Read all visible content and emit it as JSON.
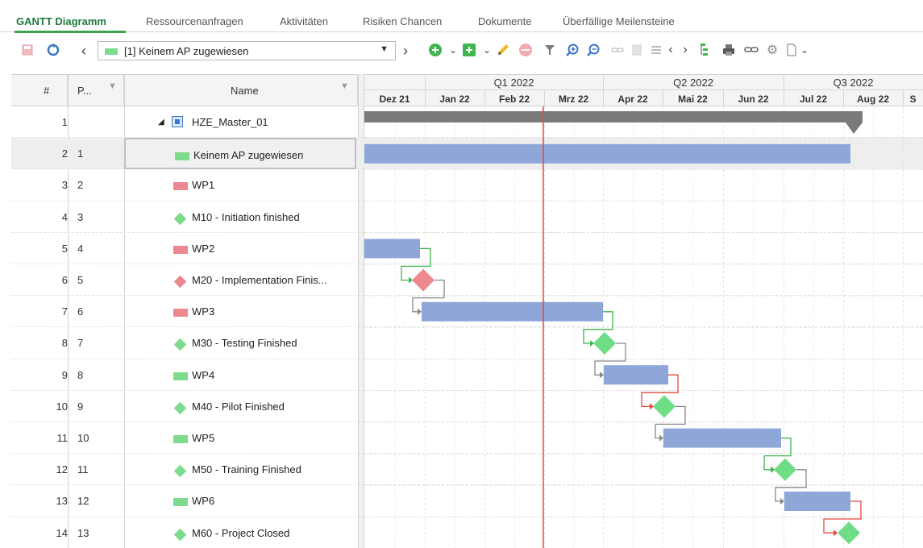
{
  "tabs": [
    {
      "label": "GANTT Diagramm",
      "active": true
    },
    {
      "label": "Ressourcenanfragen"
    },
    {
      "label": "Aktivitäten"
    },
    {
      "label": "Risiken Chancen"
    },
    {
      "label": "Dokumente"
    },
    {
      "label": "Überfällige Meilensteine"
    }
  ],
  "toolbar": {
    "prev_label": "‹",
    "next_label": "›",
    "combo_value": "[1] Keinem AP zugewiesen",
    "icons": [
      "save-icon",
      "refresh-icon",
      "add-circle-icon",
      "add-square-icon",
      "pencil-icon",
      "remove-icon",
      "filter-icon",
      "zoom-in-icon",
      "zoom-out-icon",
      "link-icon",
      "page-icon",
      "indent-icon",
      "scroll-left-icon",
      "scroll-right-icon",
      "hierarchy-icon",
      "print-icon",
      "chain-icon",
      "gear-icon",
      "export-icon"
    ]
  },
  "grid": {
    "col_hash": "#",
    "col_p": "P...",
    "col_name": "Name"
  },
  "timeline": {
    "quarters": [
      "Q1 2022",
      "Q2 2022",
      "Q3 2022"
    ],
    "months": [
      "Dez 21",
      "Jan 22",
      "Feb 22",
      "Mrz 22",
      "Apr 22",
      "Mai 22",
      "Jun 22",
      "Jul 22",
      "Aug 22",
      "S"
    ]
  },
  "rows": [
    {
      "num": "1",
      "p": "",
      "name": "HZE_Master_01",
      "type": "project"
    },
    {
      "num": "2",
      "p": "1",
      "name": "Keinem AP zugewiesen",
      "type": "green-bar",
      "selected": true
    },
    {
      "num": "3",
      "p": "2",
      "name": "WP1",
      "type": "red-bar"
    },
    {
      "num": "4",
      "p": "3",
      "name": "M10 - Initiation finished",
      "type": "green-diamond"
    },
    {
      "num": "5",
      "p": "4",
      "name": "WP2",
      "type": "red-bar"
    },
    {
      "num": "6",
      "p": "5",
      "name": "M20 - Implementation Finis...",
      "type": "red-diamond"
    },
    {
      "num": "7",
      "p": "6",
      "name": "WP3",
      "type": "red-bar"
    },
    {
      "num": "8",
      "p": "7",
      "name": "M30 - Testing Finished",
      "type": "green-diamond"
    },
    {
      "num": "9",
      "p": "8",
      "name": "WP4",
      "type": "green-bar"
    },
    {
      "num": "10",
      "p": "9",
      "name": "M40 - Pilot Finished",
      "type": "green-diamond"
    },
    {
      "num": "11",
      "p": "10",
      "name": "WP5",
      "type": "green-bar"
    },
    {
      "num": "12",
      "p": "11",
      "name": "M50 - Training Finished",
      "type": "green-diamond"
    },
    {
      "num": "13",
      "p": "12",
      "name": "WP6",
      "type": "green-bar"
    },
    {
      "num": "14",
      "p": "13",
      "name": "M60 - Project Closed",
      "type": "green-diamond"
    }
  ],
  "colors": {
    "bar": "#8fa6d9",
    "summary": "#7a7a7a",
    "milestone_green": "#6fdc86",
    "milestone_red": "#ec8890",
    "today_line": "#e8473c",
    "link_green": "#3fb54f",
    "link_red": "#e8473c",
    "link_gray": "#888888",
    "accent": "#1e7a3c"
  }
}
